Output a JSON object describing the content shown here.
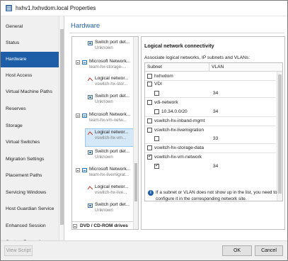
{
  "window": {
    "title": "hxhv1.hxhvdom.local Properties"
  },
  "nav": {
    "items": [
      {
        "label": "General"
      },
      {
        "label": "Status"
      },
      {
        "label": "Hardware"
      },
      {
        "label": "Host Access"
      },
      {
        "label": "Virtual Machine Paths"
      },
      {
        "label": "Reserves"
      },
      {
        "label": "Storage"
      },
      {
        "label": "Virtual Switches"
      },
      {
        "label": "Migration Settings"
      },
      {
        "label": "Placement Paths"
      },
      {
        "label": "Servicing Windows"
      },
      {
        "label": "Host Guardian Service"
      },
      {
        "label": "Enhanced Session"
      },
      {
        "label": "Custom Properties"
      }
    ],
    "active": "Hardware"
  },
  "hardware": {
    "title": "Hardware"
  },
  "tree": {
    "items": [
      {
        "label": "Switch port det...",
        "sub": "Unknown"
      },
      {
        "label": "Microsoft Network...",
        "sub": "team-hx-storage-..."
      },
      {
        "label": "Logical networ...",
        "sub": "vswitch-hx-stor..."
      },
      {
        "label": "Switch port det...",
        "sub": "Unknown"
      },
      {
        "label": "Microsoft Network...",
        "sub": "team-hx-vm-netw..."
      },
      {
        "label": "Logical networ...",
        "sub": "vswitch-hx-vm..."
      },
      {
        "label": "Switch port det...",
        "sub": "Unknown"
      },
      {
        "label": "Microsoft Network...",
        "sub": "team-hx-livemigrat..."
      },
      {
        "label": "Logical networ...",
        "sub": "vswitch-hx-live..."
      },
      {
        "label": "Switch port det...",
        "sub": "Unknown"
      }
    ],
    "dvd_label": "DVD / CD-ROM drives"
  },
  "details": {
    "title": "Logical network connectivity",
    "description": "Associate logical networks, IP subnets and VLANs:",
    "col_subnet": "Subnet",
    "col_vlan": "VLAN",
    "rows": [
      {
        "label": "hxhvdom",
        "vlan": "",
        "checked": false
      },
      {
        "label": "VDI",
        "vlan": "",
        "checked": false
      },
      {
        "label": "",
        "vlan": "34",
        "checked": false
      },
      {
        "label": "vdi-network",
        "vlan": "",
        "checked": false
      },
      {
        "label": "10.34.0.0/20",
        "vlan": "34",
        "checked": false
      },
      {
        "label": "vswitch-hx-inband-mgmt",
        "vlan": "",
        "checked": false
      },
      {
        "label": "vswitch-hx-livemigration",
        "vlan": "",
        "checked": false
      },
      {
        "label": "",
        "vlan": "33",
        "checked": false
      },
      {
        "label": "vswitch-hx-storage-data",
        "vlan": "",
        "checked": false
      },
      {
        "label": "vswitch-hx-vm-network",
        "vlan": "",
        "checked": true
      },
      {
        "label": "",
        "vlan": "34",
        "checked": true
      }
    ],
    "info": "If a subnet or VLAN does not show up in the list, you need to configure it in the corresponding network site."
  },
  "buttons": {
    "view_script": "View Script",
    "ok": "OK",
    "cancel": "Cancel"
  },
  "colors": {
    "accent": "#1e5ea8",
    "selection": "#d5e8f7"
  }
}
